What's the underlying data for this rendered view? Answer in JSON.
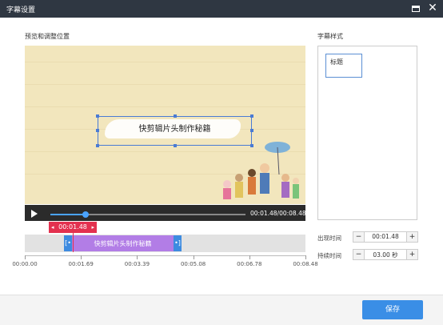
{
  "window": {
    "title": "字幕设置"
  },
  "preview": {
    "label": "预览和调整位置",
    "caption_text": "快剪辑片头制作秘籍",
    "time_display": "00:01.48/00:08.48",
    "playback_progress": 0.18
  },
  "styles": {
    "label": "字幕样式",
    "items": [
      {
        "label": "标题",
        "selected": true
      }
    ]
  },
  "timeline": {
    "current_marker": "00:01.48",
    "clip_label": "快剪辑片头制作秘籍",
    "clip_start": "00:01.48",
    "clip_end": "00:04.48",
    "ticks": [
      "00:00.00",
      "00:01.69",
      "00:03.39",
      "00:05.08",
      "00:06.78",
      "00:08.48"
    ]
  },
  "settings": {
    "appear_label": "出现时间",
    "appear_value": "00:01.48",
    "duration_label": "持续时间",
    "duration_value": "03.00 秒"
  },
  "footer": {
    "save_label": "保存"
  },
  "colors": {
    "accent": "#3a8ee6",
    "marker": "#e3314f",
    "clip": "#b27de6",
    "titlebar": "#2f3742"
  }
}
